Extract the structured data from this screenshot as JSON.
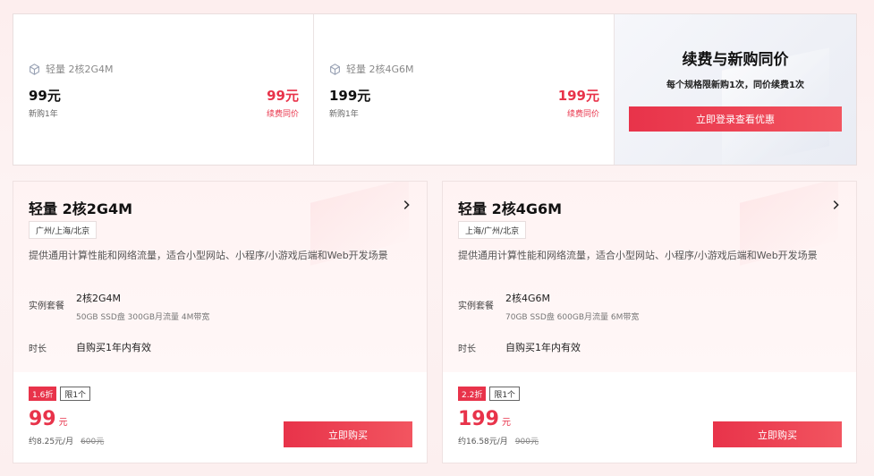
{
  "top_cards": [
    {
      "name": "轻量 2核2G4M",
      "price": "99元",
      "sub": "新购1年",
      "renew_price": "99元",
      "renew_label": "续费同价"
    },
    {
      "name": "轻量 2核4G6M",
      "price": "199元",
      "sub": "新购1年",
      "renew_price": "199元",
      "renew_label": "续费同价"
    }
  ],
  "promo": {
    "title": "续费与新购同价",
    "subtitle": "每个规格限新购1次，同价续费1次",
    "button": "立即登录查看优惠"
  },
  "products": [
    {
      "title": "轻量 2核2G4M",
      "region": "广州/上海/北京",
      "desc": "提供通用计算性能和网络流量，适合小型网站、小程序/小游戏后端和Web开发场景",
      "spec_label": "实例套餐",
      "spec": "2核2G4M",
      "spec_detail": "50GB SSD盘 300GB月流量 4M带宽",
      "duration_label": "时长",
      "duration": "自购买1年内有效",
      "discount": "1.6折",
      "limit": "限1个",
      "price": "99",
      "unit": "元",
      "monthly": "约8.25元/月",
      "original": "600元",
      "buy": "立即购买"
    },
    {
      "title": "轻量 2核4G6M",
      "region": "上海/广州/北京",
      "desc": "提供通用计算性能和网络流量，适合小型网站、小程序/小游戏后端和Web开发场景",
      "spec_label": "实例套餐",
      "spec": "2核4G6M",
      "spec_detail": "70GB SSD盘 600GB月流量 6M带宽",
      "duration_label": "时长",
      "duration": "自购买1年内有效",
      "discount": "2.2折",
      "limit": "限1个",
      "price": "199",
      "unit": "元",
      "monthly": "约16.58元/月",
      "original": "900元",
      "buy": "立即购买"
    }
  ],
  "colors": {
    "accent": "#e8334a",
    "text": "#1f1f1f"
  },
  "icons": {
    "product": "cube-icon",
    "chevron": "chevron-right-icon"
  }
}
